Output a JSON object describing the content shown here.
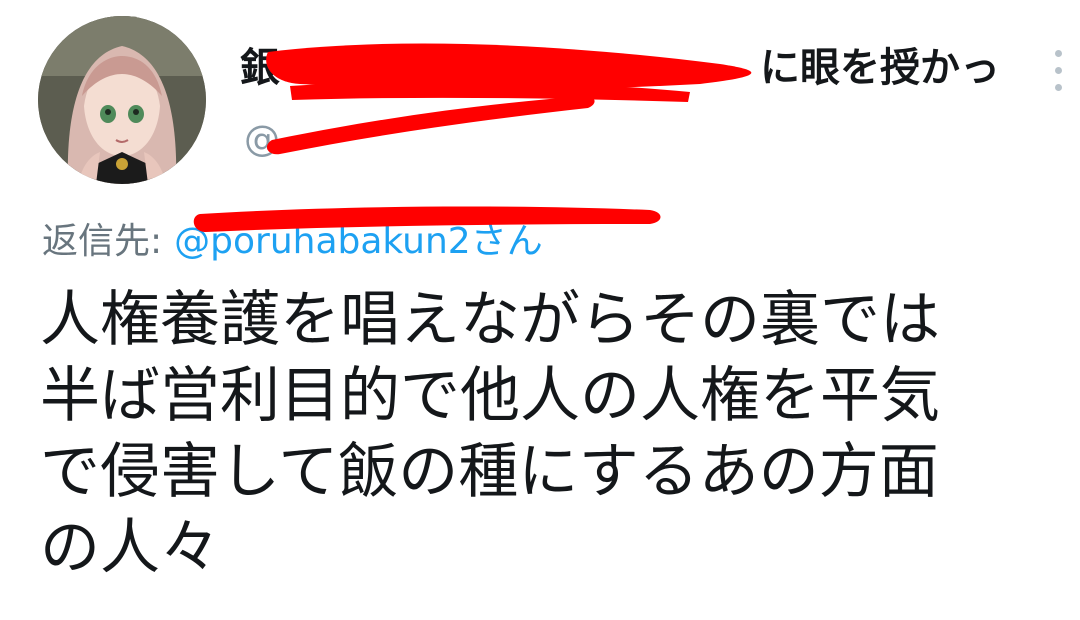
{
  "profile": {
    "avatar_alt": "avatar",
    "display_name": "銀　　　　　　　　　　　　に眼を授かっ…",
    "handle": "@"
  },
  "reply": {
    "label": "返信先:",
    "target": "@poruhabakun2さん"
  },
  "tweet": {
    "text": "人権養護を唱えながらその裏では\n半ば営利目的で他人の人権を平気\nで侵害して飯の種にするあの方面\nの人々"
  },
  "menu": {
    "icon": "more-vertical-icon"
  },
  "colors": {
    "redaction": "#ff0000",
    "link": "#1da1f2",
    "secondary": "#8a9aa6",
    "text": "#14171a"
  }
}
